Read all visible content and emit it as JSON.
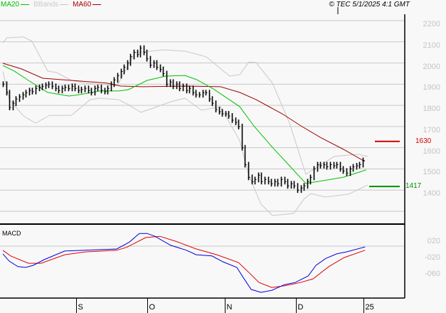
{
  "legend": {
    "ma20": "MA20",
    "bbands": "BBands",
    "ma60": "MA60"
  },
  "copyright": "© TEC 5/1/2025 4:1 GMT",
  "colors": {
    "ma20": "#00c000",
    "bbands": "#c8c8c8",
    "ma60": "#a00000",
    "macd": "#0000e0",
    "signal": "#e00000",
    "bars": "#000000",
    "tag_ma60": "#d00000",
    "tag_ma20": "#009000"
  },
  "chart_data": [
    {
      "type": "ohlc",
      "title": "Price",
      "ylim": [
        1300,
        2200
      ],
      "y_ticks": [
        {
          "v": 2200,
          "label": "2200"
        },
        {
          "v": 2100,
          "label": "2100"
        },
        {
          "v": 2000,
          "label": "2000"
        },
        {
          "v": 1900,
          "label": "1900"
        },
        {
          "v": 1800,
          "label": "1800"
        },
        {
          "v": 1700,
          "label": "1700"
        },
        {
          "v": 1600,
          "label": "1600"
        },
        {
          "v": 1500,
          "label": "1500"
        },
        {
          "v": 1400,
          "label": "1400"
        }
      ],
      "bar_half_range": 22,
      "closes": [
        1900,
        1860,
        1790,
        1810,
        1830,
        1840,
        1850,
        1860,
        1870,
        1865,
        1880,
        1885,
        1890,
        1895,
        1900,
        1890,
        1880,
        1870,
        1880,
        1885,
        1880,
        1890,
        1880,
        1870,
        1875,
        1880,
        1870,
        1860,
        1880,
        1885,
        1870,
        1865,
        1880,
        1900,
        1920,
        1940,
        1960,
        1980,
        2000,
        2030,
        2050,
        2040,
        2070,
        2050,
        2020,
        1990,
        2000,
        1980,
        1970,
        1950,
        1900,
        1910,
        1890,
        1900,
        1880,
        1890,
        1870,
        1880,
        1860,
        1850,
        1850,
        1860,
        1860,
        1830,
        1810,
        1780,
        1770,
        1760,
        1760,
        1750,
        1730,
        1720,
        1700,
        1600,
        1520,
        1460,
        1440,
        1450,
        1470,
        1440,
        1450,
        1440,
        1430,
        1440,
        1430,
        1450,
        1440,
        1420,
        1430,
        1420,
        1400,
        1410,
        1420,
        1440,
        1460,
        1500,
        1520,
        1515,
        1520,
        1510,
        1520,
        1515,
        1520,
        1500,
        1490,
        1480,
        1500,
        1510,
        1515,
        1520,
        1540
      ],
      "ma20": [
        [
          0,
          1988
        ],
        [
          3.5,
          1962
        ],
        [
          7.8,
          1918
        ],
        [
          13.7,
          1861
        ],
        [
          20.2,
          1844
        ],
        [
          23.7,
          1851
        ],
        [
          29.6,
          1868
        ],
        [
          35.4,
          1868
        ],
        [
          38.3,
          1874
        ],
        [
          44.1,
          1918
        ],
        [
          49.8,
          1938
        ],
        [
          55.7,
          1941
        ],
        [
          59.3,
          1921
        ],
        [
          64.3,
          1878
        ],
        [
          72.4,
          1794
        ],
        [
          76.7,
          1703
        ],
        [
          82.4,
          1602
        ],
        [
          87.6,
          1515
        ],
        [
          92.6,
          1431
        ],
        [
          104.1,
          1461
        ],
        [
          111,
          1495
        ]
      ],
      "ma60": [
        [
          0,
          1999
        ],
        [
          5.7,
          1972
        ],
        [
          12.2,
          1928
        ],
        [
          20.9,
          1918
        ],
        [
          31.7,
          1905
        ],
        [
          36,
          1891
        ],
        [
          42.6,
          1888
        ],
        [
          55.7,
          1891
        ],
        [
          66.5,
          1888
        ],
        [
          72.4,
          1861
        ],
        [
          77.4,
          1827
        ],
        [
          85.4,
          1760
        ],
        [
          91.1,
          1703
        ],
        [
          97,
          1649
        ],
        [
          104.1,
          1592
        ],
        [
          110.6,
          1535
        ]
      ],
      "bb_upper": [
        [
          0,
          2096
        ],
        [
          1.3,
          2119
        ],
        [
          6.3,
          2123
        ],
        [
          8.9,
          2103
        ],
        [
          13.7,
          1962
        ],
        [
          16.5,
          1955
        ],
        [
          20.9,
          1918
        ],
        [
          25.2,
          1905
        ],
        [
          35,
          1894
        ],
        [
          40.4,
          2049
        ],
        [
          49.1,
          2062
        ],
        [
          55.7,
          2056
        ],
        [
          62.2,
          2029
        ],
        [
          69.3,
          1938
        ],
        [
          72.4,
          1945
        ],
        [
          75.2,
          2005
        ],
        [
          77.4,
          2002
        ],
        [
          82.4,
          1905
        ],
        [
          87.6,
          1716
        ],
        [
          90.4,
          1582
        ],
        [
          92.6,
          1475
        ],
        [
          95.4,
          1502
        ],
        [
          101.3,
          1559
        ],
        [
          108.5,
          1569
        ],
        [
          111.5,
          1559
        ]
      ],
      "bb_lower": [
        [
          0,
          1960
        ],
        [
          2,
          1827
        ],
        [
          6.3,
          1750
        ],
        [
          10,
          1716
        ],
        [
          14.3,
          1753
        ],
        [
          20.9,
          1753
        ],
        [
          26.7,
          1827
        ],
        [
          29.6,
          1834
        ],
        [
          35.4,
          1827
        ],
        [
          38.3,
          1804
        ],
        [
          42.2,
          1767
        ],
        [
          45.4,
          1784
        ],
        [
          51.3,
          1817
        ],
        [
          55.7,
          1834
        ],
        [
          60.7,
          1777
        ],
        [
          66.5,
          1794
        ],
        [
          72.4,
          1633
        ],
        [
          75.2,
          1468
        ],
        [
          78.9,
          1334
        ],
        [
          82.4,
          1280
        ],
        [
          88.9,
          1290
        ],
        [
          92,
          1357
        ],
        [
          94.1,
          1384
        ],
        [
          98.5,
          1367
        ],
        [
          105.7,
          1381
        ],
        [
          111.5,
          1424
        ]
      ],
      "tags": [
        {
          "name": "ma60",
          "value": 1630,
          "label": "1630"
        },
        {
          "name": "ma20",
          "value": 1417,
          "label": "1417"
        }
      ]
    },
    {
      "type": "line",
      "title": "MACD",
      "y_ticks": [
        {
          "v": 0.2,
          "label": "020"
        },
        {
          "v": -0.2,
          "label": "-020"
        },
        {
          "v": -0.6,
          "label": "-060"
        }
      ],
      "gridlines": [
        0.2
      ],
      "macd": [
        [
          0,
          0.01
        ],
        [
          2,
          -0.17
        ],
        [
          4.6,
          -0.3
        ],
        [
          7,
          -0.32
        ],
        [
          9.3,
          -0.27
        ],
        [
          12.6,
          -0.13
        ],
        [
          18.9,
          0.08
        ],
        [
          25.2,
          0.1
        ],
        [
          34.8,
          0.13
        ],
        [
          38.7,
          0.3
        ],
        [
          41.7,
          0.51
        ],
        [
          44.1,
          0.51
        ],
        [
          46.5,
          0.44
        ],
        [
          51.3,
          0.22
        ],
        [
          56.1,
          0.1
        ],
        [
          59.1,
          -0.01
        ],
        [
          63.9,
          -0.04
        ],
        [
          67.2,
          -0.18
        ],
        [
          71.5,
          -0.32
        ],
        [
          73.5,
          -0.57
        ],
        [
          75.9,
          -0.86
        ],
        [
          78.9,
          -0.93
        ],
        [
          82.2,
          -0.88
        ],
        [
          86.1,
          -0.74
        ],
        [
          89.3,
          -0.69
        ],
        [
          93.3,
          -0.53
        ],
        [
          95.7,
          -0.27
        ],
        [
          98.7,
          -0.1
        ],
        [
          102,
          0.01
        ],
        [
          105,
          0.06
        ],
        [
          110.7,
          0.18
        ]
      ],
      "signal": [
        [
          0,
          0.1
        ],
        [
          2.4,
          -0.04
        ],
        [
          7.8,
          -0.22
        ],
        [
          11.7,
          -0.22
        ],
        [
          18.9,
          -0.01
        ],
        [
          25.2,
          0.06
        ],
        [
          34.8,
          0.1
        ],
        [
          37.8,
          0.17
        ],
        [
          43.7,
          0.41
        ],
        [
          48,
          0.44
        ],
        [
          52.8,
          0.32
        ],
        [
          59.1,
          0.13
        ],
        [
          65.4,
          -0.01
        ],
        [
          72,
          -0.2
        ],
        [
          75,
          -0.43
        ],
        [
          78.3,
          -0.69
        ],
        [
          82.2,
          -0.81
        ],
        [
          86.1,
          -0.77
        ],
        [
          90.9,
          -0.69
        ],
        [
          94.8,
          -0.6
        ],
        [
          99.6,
          -0.3
        ],
        [
          104.3,
          -0.08
        ],
        [
          110.7,
          0.1
        ]
      ]
    }
  ],
  "x_axis": [
    {
      "bar": 22.4,
      "label": "S"
    },
    {
      "bar": 44.1,
      "label": "O"
    },
    {
      "bar": 67.8,
      "label": "N"
    },
    {
      "bar": 89.6,
      "label": "D"
    },
    {
      "bar": 110.2,
      "label": "25"
    }
  ]
}
